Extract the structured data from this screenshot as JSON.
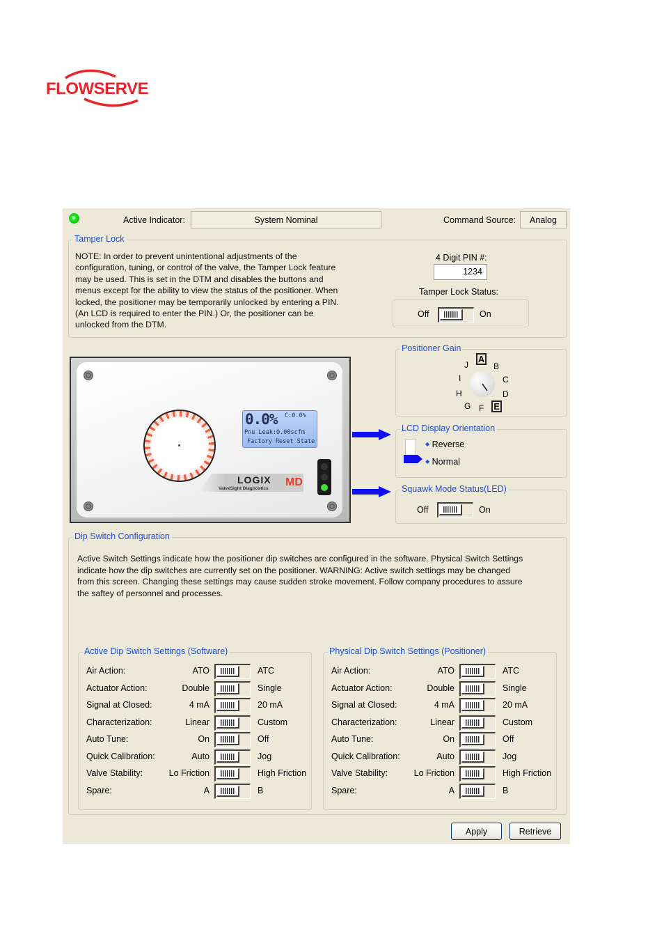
{
  "brand": {
    "logo_text": "FLOWSERVE",
    "logo_color": "#e8242c"
  },
  "status_bar": {
    "led_color": "#22ee22",
    "active_indicator_label": "Active Indicator:",
    "active_indicator_value": "System Nominal",
    "command_source_label": "Command Source:",
    "command_source_value": "Analog"
  },
  "tamper_lock": {
    "title": "Tamper Lock",
    "note": "NOTE: In order to prevent unintentional adjustments of the configuration, tuning, or control of the valve, the Tamper Lock feature may be used. This is set in the DTM and disables the buttons and menus except for the ability to view the status of the positioner. When locked, the positioner may be temporarily unlocked by entering a PIN. (An LCD is required to enter the PIN.) Or, the positioner can be unlocked from the DTM.",
    "note_lines": [
      "NOTE: In order to prevent unintentional adjustments of the",
      "configuration, tuning, or control of the valve, the Tamper Lock feature",
      "may be used. This is set in the DTM and disables the buttons and",
      "menus except for the ability to view the status of the positioner. When",
      "locked, the positioner may be temporarily unlocked by entering a PIN.",
      "(An LCD is required to enter the PIN.) Or, the positioner can be",
      "unlocked from the DTM."
    ],
    "pin_label": "4 Digit PIN #:",
    "pin_value": "1234",
    "status_label": "Tamper Lock Status:",
    "toggle_off": "Off",
    "toggle_on": "On",
    "toggle_state": "Off"
  },
  "device_image": {
    "lcd_big": "0.0%",
    "lcd_cmd": "C:0.0%",
    "lcd_line2": "Pnu Leak:0.00scfm",
    "lcd_line3": "Factory Reset State",
    "product_name": "LOGIX",
    "product_sub": "ValveSight Diagnostics",
    "product_badge": "MD"
  },
  "positioner_gain": {
    "title": "Positioner Gain",
    "letters": [
      "A",
      "B",
      "C",
      "D",
      "E",
      "F",
      "G",
      "H",
      "I",
      "J"
    ],
    "boxed": [
      "A",
      "E"
    ],
    "selected": "E"
  },
  "lcd_orientation": {
    "title": "LCD Display Orientation",
    "options": [
      "Reverse",
      "Normal"
    ],
    "selected": "Normal"
  },
  "squawk": {
    "title": "Squawk Mode Status(LED)",
    "toggle_off": "Off",
    "toggle_on": "On",
    "toggle_state": "Off"
  },
  "dip_switch": {
    "title": "Dip Switch Configuration",
    "description_lines": [
      "Active Switch Settings indicate how the positioner dip switches are configured in the software.  Physical Switch Settings",
      "indicate how the dip switches are currently set on the positioner.  WARNING: Active switch settings may be changed",
      "from this screen.  Changing these settings may cause sudden stroke movement.  Follow company procedures to assure",
      "the saftey of personnel and processes."
    ],
    "active": {
      "title": "Active Dip Switch Settings (Software)",
      "rows": [
        {
          "name": "Air Action:",
          "left": "ATO",
          "right": "ATC",
          "state": "left"
        },
        {
          "name": "Actuator Action:",
          "left": "Double",
          "right": "Single",
          "state": "left"
        },
        {
          "name": "Signal at Closed:",
          "left": "4 mA",
          "right": "20 mA",
          "state": "left"
        },
        {
          "name": "Characterization:",
          "left": "Linear",
          "right": "Custom",
          "state": "left"
        },
        {
          "name": "Auto Tune:",
          "left": "On",
          "right": "Off",
          "state": "left"
        },
        {
          "name": "Quick Calibration:",
          "left": "Auto",
          "right": "Jog",
          "state": "left"
        },
        {
          "name": "Valve Stability:",
          "left": "Lo Friction",
          "right": "High Friction",
          "state": "left"
        },
        {
          "name": "Spare:",
          "left": "A",
          "right": "B",
          "state": "left"
        }
      ]
    },
    "physical": {
      "title": "Physical Dip Switch Settings (Positioner)",
      "rows": [
        {
          "name": "Air Action:",
          "left": "ATO",
          "right": "ATC",
          "state": "left"
        },
        {
          "name": "Actuator Action:",
          "left": "Double",
          "right": "Single",
          "state": "left"
        },
        {
          "name": "Signal at Closed:",
          "left": "4 mA",
          "right": "20 mA",
          "state": "left"
        },
        {
          "name": "Characterization:",
          "left": "Linear",
          "right": "Custom",
          "state": "left"
        },
        {
          "name": "Auto Tune:",
          "left": "On",
          "right": "Off",
          "state": "left"
        },
        {
          "name": "Quick Calibration:",
          "left": "Auto",
          "right": "Jog",
          "state": "left"
        },
        {
          "name": "Valve Stability:",
          "left": "Lo Friction",
          "right": "High Friction",
          "state": "left"
        },
        {
          "name": "Spare:",
          "left": "A",
          "right": "B",
          "state": "left"
        }
      ]
    }
  },
  "buttons": {
    "apply": "Apply",
    "retrieve": "Retrieve"
  },
  "colors": {
    "panel_bg": "#ece9d8",
    "group_title": "#1f4fcf",
    "arrow": "#1010ee"
  }
}
